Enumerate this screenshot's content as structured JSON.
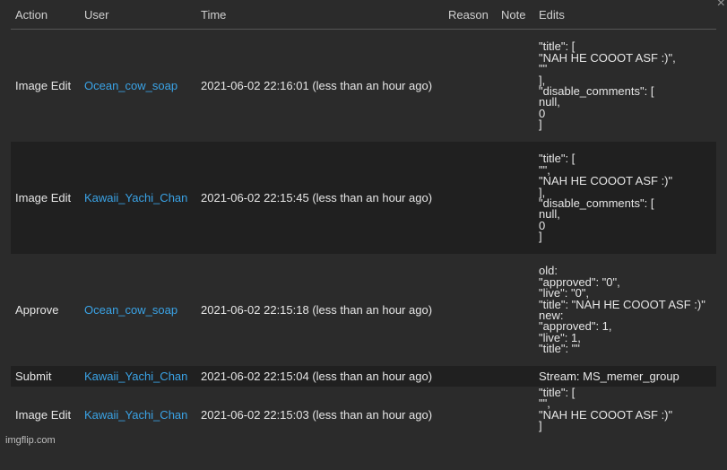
{
  "headers": {
    "action": "Action",
    "user": "User",
    "time": "Time",
    "reason": "Reason",
    "note": "Note",
    "edits": "Edits"
  },
  "close_glyph": "×",
  "rows": [
    {
      "action": "Image Edit",
      "user": "Ocean_cow_soap",
      "time": "2021-06-02 22:16:01 (less than an hour ago)",
      "reason": "",
      "note": "",
      "edits": [
        "\"title\": [",
        "\"NAH HE COOOT ASF :)\",",
        "\"\"",
        "],",
        "\"disable_comments\": [",
        "null,",
        "0",
        "]"
      ]
    },
    {
      "action": "Image Edit",
      "user": "Kawaii_Yachi_Chan",
      "time": "2021-06-02 22:15:45 (less than an hour ago)",
      "reason": "",
      "note": "",
      "edits": [
        "\"title\": [",
        "\"\",",
        "\"NAH HE COOOT ASF :)\"",
        "],",
        "\"disable_comments\": [",
        "null,",
        "0",
        "]"
      ]
    },
    {
      "action": "Approve",
      "user": "Ocean_cow_soap",
      "time": "2021-06-02 22:15:18 (less than an hour ago)",
      "reason": "",
      "note": "",
      "edits": [
        "old:",
        "\"approved\": \"0\",",
        "\"live\": \"0\",",
        "\"title\": \"NAH HE COOOT ASF :)\"",
        "new:",
        "\"approved\": 1,",
        "\"live\": 1,",
        "\"title\": \"\""
      ]
    },
    {
      "action": "Submit",
      "user": "Kawaii_Yachi_Chan",
      "time": "2021-06-02 22:15:04 (less than an hour ago)",
      "reason": "",
      "note": "",
      "edits": [
        "Stream: MS_memer_group"
      ]
    },
    {
      "action": "Image Edit",
      "user": "Kawaii_Yachi_Chan",
      "time": "2021-06-02 22:15:03 (less than an hour ago)",
      "reason": "",
      "note": "",
      "edits": [
        "\"title\": [",
        "\"\",",
        "\"NAH HE COOOT ASF :)\"",
        "]"
      ]
    }
  ],
  "watermark": "imgflip.com"
}
